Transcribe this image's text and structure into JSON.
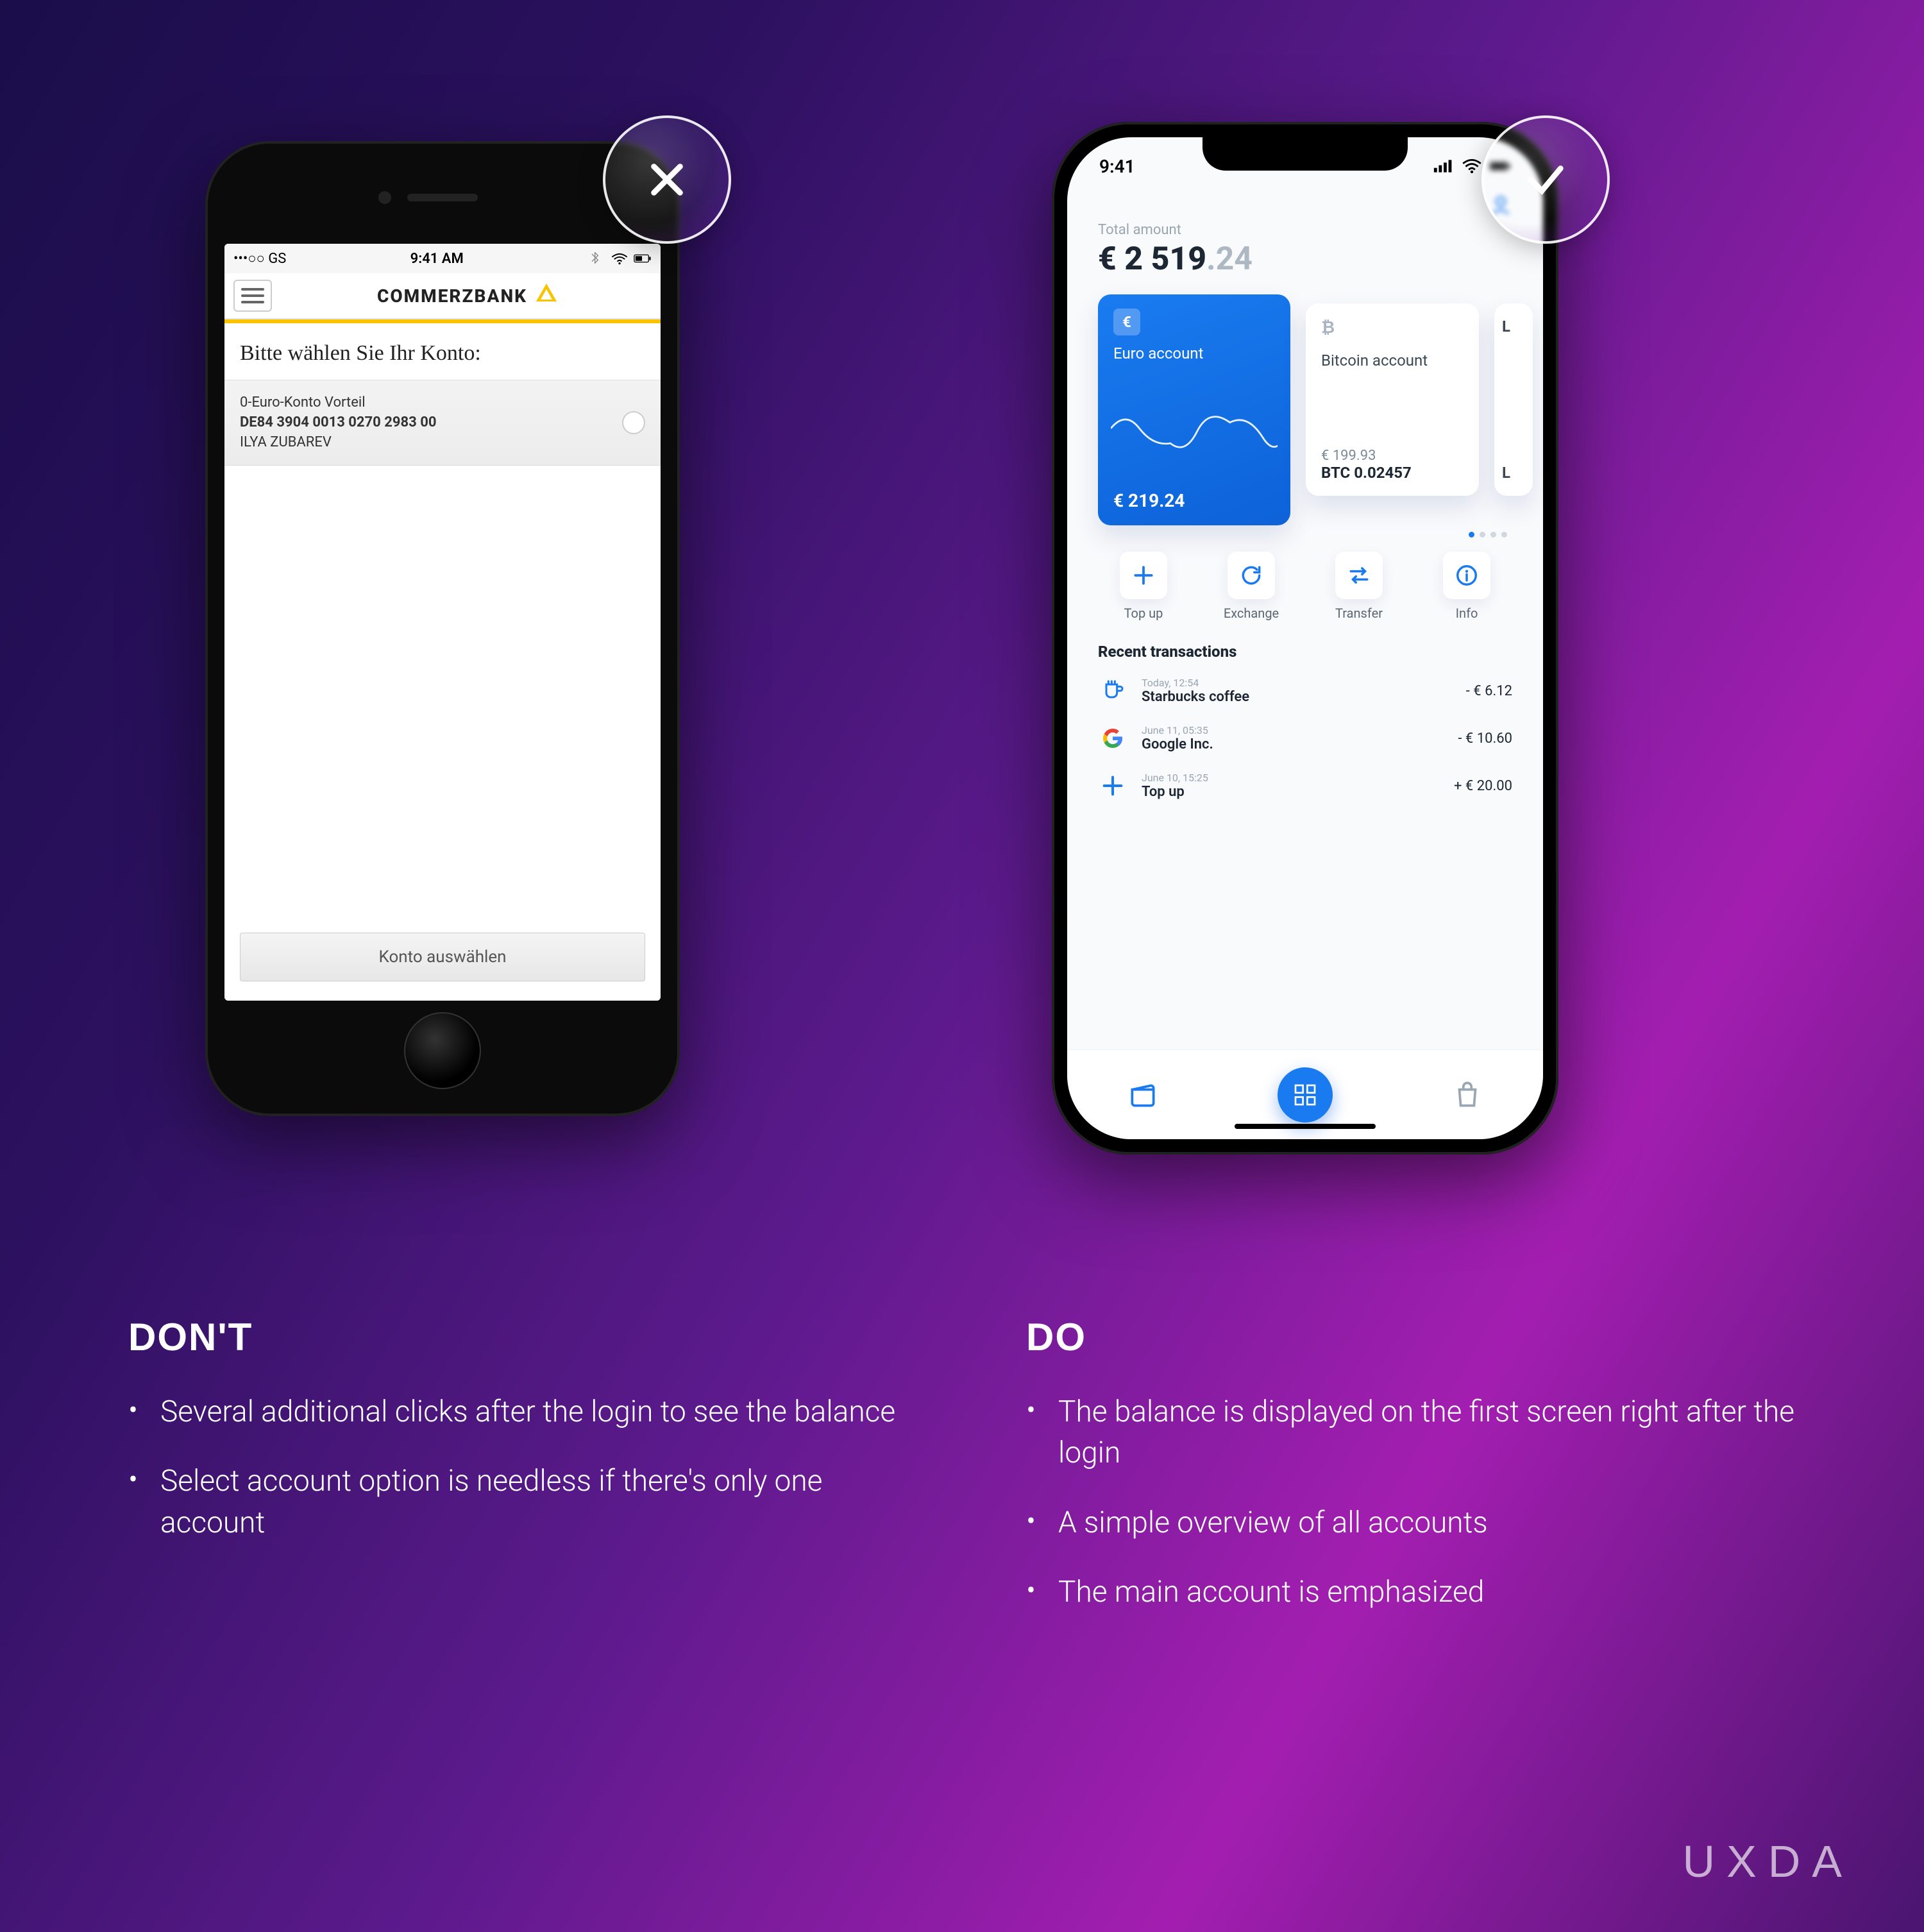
{
  "badges": {
    "bad_icon": "x",
    "good_icon": "check"
  },
  "left_phone": {
    "status": {
      "carrier": "•••○○ GS",
      "time": "9:41 AM"
    },
    "bank_name": "COMMERZBANK",
    "prompt": "Bitte wählen Sie Ihr Konto:",
    "account": {
      "line1": "0-Euro-Konto Vorteil",
      "iban": "DE84 3904 0013 0270 2983 00",
      "holder": "ILYA ZUBAREV"
    },
    "cta": "Konto auswählen"
  },
  "right_phone": {
    "status_time": "9:41",
    "total_label": "Total amount",
    "total_amount_main": "€ 2 519",
    "total_amount_dec": ".24",
    "cards": {
      "primary": {
        "symbol": "€",
        "name": "Euro account",
        "balance": "€ 219.24"
      },
      "secondary": {
        "symbol": "₿",
        "name": "Bitcoin account",
        "fiat": "€ 199.93",
        "crypto": "BTC 0.02457"
      },
      "third": {
        "top": "L",
        "bottom": "L"
      }
    },
    "actions": [
      {
        "label": "Top up",
        "icon": "plus"
      },
      {
        "label": "Exchange",
        "icon": "refresh"
      },
      {
        "label": "Transfer",
        "icon": "swap"
      },
      {
        "label": "Info",
        "icon": "info"
      }
    ],
    "recent_header": "Recent transactions",
    "transactions": [
      {
        "time": "Today, 12:54",
        "name": "Starbucks coffee",
        "amount": "- € 6.12",
        "icon": "cup"
      },
      {
        "time": "June 11, 05:35",
        "name": "Google Inc.",
        "amount": "- € 10.60",
        "icon": "google"
      },
      {
        "time": "June 10, 15:25",
        "name": "Top up",
        "amount": "+ € 20.00",
        "icon": "plus"
      }
    ]
  },
  "text": {
    "dont_heading": "DON'T",
    "dont_bullets": [
      "Several additional clicks after the login to see the balance",
      "Select account option is needless if there's only one account"
    ],
    "do_heading": "DO",
    "do_bullets": [
      "The balance is displayed on the first screen right after the login",
      "A simple overview of all accounts",
      "The main account is emphasized"
    ]
  },
  "brand": "UXDA"
}
